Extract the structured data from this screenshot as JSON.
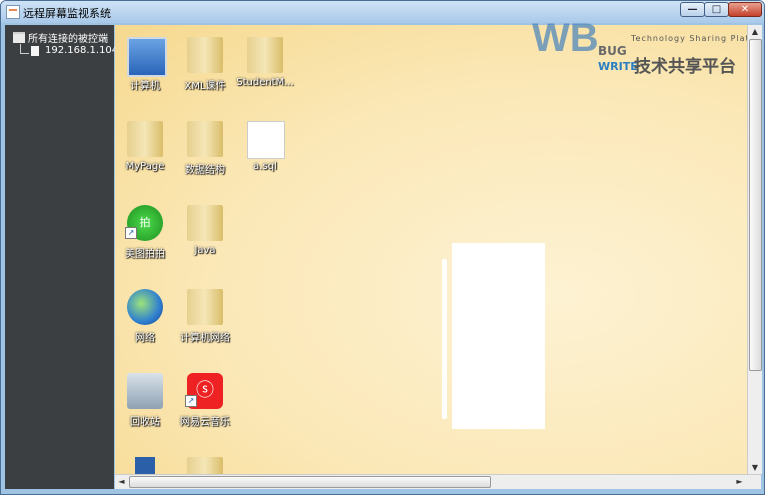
{
  "window": {
    "title": "远程屏幕监视系统"
  },
  "tree": {
    "root_label": "所有连接的被控端",
    "children": [
      {
        "label": "192.168.1.104"
      }
    ]
  },
  "desktop_icons": [
    {
      "label": "计算机",
      "icon": "computer-icon"
    },
    {
      "label": "XML课件",
      "icon": "folder-icon"
    },
    {
      "label": "StudentM...",
      "icon": "folder-icon"
    },
    {
      "label": "MyPage",
      "icon": "folder-icon"
    },
    {
      "label": "数据结构",
      "icon": "folder-icon"
    },
    {
      "label": "a.sql",
      "icon": "document-icon"
    },
    {
      "label": "美图拍拍",
      "icon": "app-icon"
    },
    {
      "label": "Java",
      "icon": "folder-icon"
    },
    {
      "label": "网络",
      "icon": "network-globe-icon"
    },
    {
      "label": "计算机网络",
      "icon": "folder-icon"
    },
    {
      "label": "回收站",
      "icon": "recycle-bin-icon"
    },
    {
      "label": "网易云音乐",
      "icon": "netease-music-icon"
    }
  ],
  "watermark": {
    "big": "WB",
    "bug": "BUG",
    "write": "WRITE",
    "tagline": "Technology Sharing Platfo",
    "cn": "技术共享平台"
  },
  "controls": {
    "minimize": "—",
    "maximize": "□",
    "close": "✕"
  },
  "scroll": {
    "up": "▲",
    "down": "▼",
    "left": "◄",
    "right": "►"
  },
  "colors": {
    "tree_background": "#3c3f41",
    "desktop_background": "#fbe8b7",
    "titlebar": "#a9c9ea"
  }
}
